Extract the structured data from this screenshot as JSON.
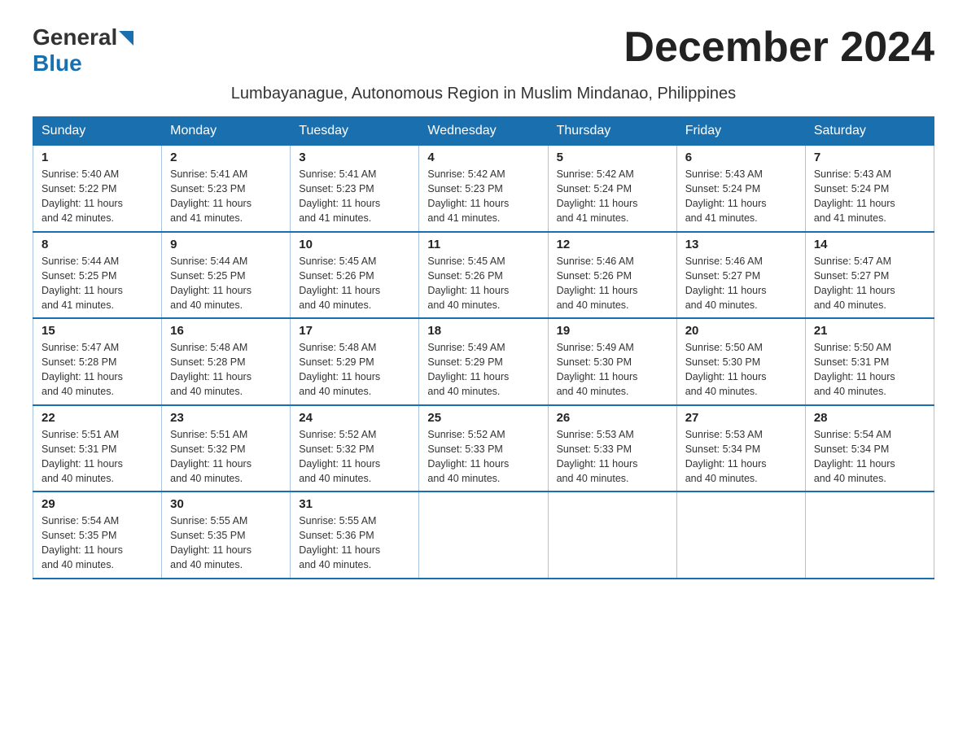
{
  "logo": {
    "general": "General",
    "blue": "Blue"
  },
  "title": "December 2024",
  "subtitle": "Lumbayanague, Autonomous Region in Muslim Mindanao, Philippines",
  "days_of_week": [
    "Sunday",
    "Monday",
    "Tuesday",
    "Wednesday",
    "Thursday",
    "Friday",
    "Saturday"
  ],
  "weeks": [
    [
      {
        "day": "1",
        "sunrise": "5:40 AM",
        "sunset": "5:22 PM",
        "daylight": "11 hours and 42 minutes."
      },
      {
        "day": "2",
        "sunrise": "5:41 AM",
        "sunset": "5:23 PM",
        "daylight": "11 hours and 41 minutes."
      },
      {
        "day": "3",
        "sunrise": "5:41 AM",
        "sunset": "5:23 PM",
        "daylight": "11 hours and 41 minutes."
      },
      {
        "day": "4",
        "sunrise": "5:42 AM",
        "sunset": "5:23 PM",
        "daylight": "11 hours and 41 minutes."
      },
      {
        "day": "5",
        "sunrise": "5:42 AM",
        "sunset": "5:24 PM",
        "daylight": "11 hours and 41 minutes."
      },
      {
        "day": "6",
        "sunrise": "5:43 AM",
        "sunset": "5:24 PM",
        "daylight": "11 hours and 41 minutes."
      },
      {
        "day": "7",
        "sunrise": "5:43 AM",
        "sunset": "5:24 PM",
        "daylight": "11 hours and 41 minutes."
      }
    ],
    [
      {
        "day": "8",
        "sunrise": "5:44 AM",
        "sunset": "5:25 PM",
        "daylight": "11 hours and 41 minutes."
      },
      {
        "day": "9",
        "sunrise": "5:44 AM",
        "sunset": "5:25 PM",
        "daylight": "11 hours and 40 minutes."
      },
      {
        "day": "10",
        "sunrise": "5:45 AM",
        "sunset": "5:26 PM",
        "daylight": "11 hours and 40 minutes."
      },
      {
        "day": "11",
        "sunrise": "5:45 AM",
        "sunset": "5:26 PM",
        "daylight": "11 hours and 40 minutes."
      },
      {
        "day": "12",
        "sunrise": "5:46 AM",
        "sunset": "5:26 PM",
        "daylight": "11 hours and 40 minutes."
      },
      {
        "day": "13",
        "sunrise": "5:46 AM",
        "sunset": "5:27 PM",
        "daylight": "11 hours and 40 minutes."
      },
      {
        "day": "14",
        "sunrise": "5:47 AM",
        "sunset": "5:27 PM",
        "daylight": "11 hours and 40 minutes."
      }
    ],
    [
      {
        "day": "15",
        "sunrise": "5:47 AM",
        "sunset": "5:28 PM",
        "daylight": "11 hours and 40 minutes."
      },
      {
        "day": "16",
        "sunrise": "5:48 AM",
        "sunset": "5:28 PM",
        "daylight": "11 hours and 40 minutes."
      },
      {
        "day": "17",
        "sunrise": "5:48 AM",
        "sunset": "5:29 PM",
        "daylight": "11 hours and 40 minutes."
      },
      {
        "day": "18",
        "sunrise": "5:49 AM",
        "sunset": "5:29 PM",
        "daylight": "11 hours and 40 minutes."
      },
      {
        "day": "19",
        "sunrise": "5:49 AM",
        "sunset": "5:30 PM",
        "daylight": "11 hours and 40 minutes."
      },
      {
        "day": "20",
        "sunrise": "5:50 AM",
        "sunset": "5:30 PM",
        "daylight": "11 hours and 40 minutes."
      },
      {
        "day": "21",
        "sunrise": "5:50 AM",
        "sunset": "5:31 PM",
        "daylight": "11 hours and 40 minutes."
      }
    ],
    [
      {
        "day": "22",
        "sunrise": "5:51 AM",
        "sunset": "5:31 PM",
        "daylight": "11 hours and 40 minutes."
      },
      {
        "day": "23",
        "sunrise": "5:51 AM",
        "sunset": "5:32 PM",
        "daylight": "11 hours and 40 minutes."
      },
      {
        "day": "24",
        "sunrise": "5:52 AM",
        "sunset": "5:32 PM",
        "daylight": "11 hours and 40 minutes."
      },
      {
        "day": "25",
        "sunrise": "5:52 AM",
        "sunset": "5:33 PM",
        "daylight": "11 hours and 40 minutes."
      },
      {
        "day": "26",
        "sunrise": "5:53 AM",
        "sunset": "5:33 PM",
        "daylight": "11 hours and 40 minutes."
      },
      {
        "day": "27",
        "sunrise": "5:53 AM",
        "sunset": "5:34 PM",
        "daylight": "11 hours and 40 minutes."
      },
      {
        "day": "28",
        "sunrise": "5:54 AM",
        "sunset": "5:34 PM",
        "daylight": "11 hours and 40 minutes."
      }
    ],
    [
      {
        "day": "29",
        "sunrise": "5:54 AM",
        "sunset": "5:35 PM",
        "daylight": "11 hours and 40 minutes."
      },
      {
        "day": "30",
        "sunrise": "5:55 AM",
        "sunset": "5:35 PM",
        "daylight": "11 hours and 40 minutes."
      },
      {
        "day": "31",
        "sunrise": "5:55 AM",
        "sunset": "5:36 PM",
        "daylight": "11 hours and 40 minutes."
      },
      null,
      null,
      null,
      null
    ]
  ],
  "cell_labels": {
    "sunrise": "Sunrise:",
    "sunset": "Sunset:",
    "daylight": "Daylight:"
  }
}
